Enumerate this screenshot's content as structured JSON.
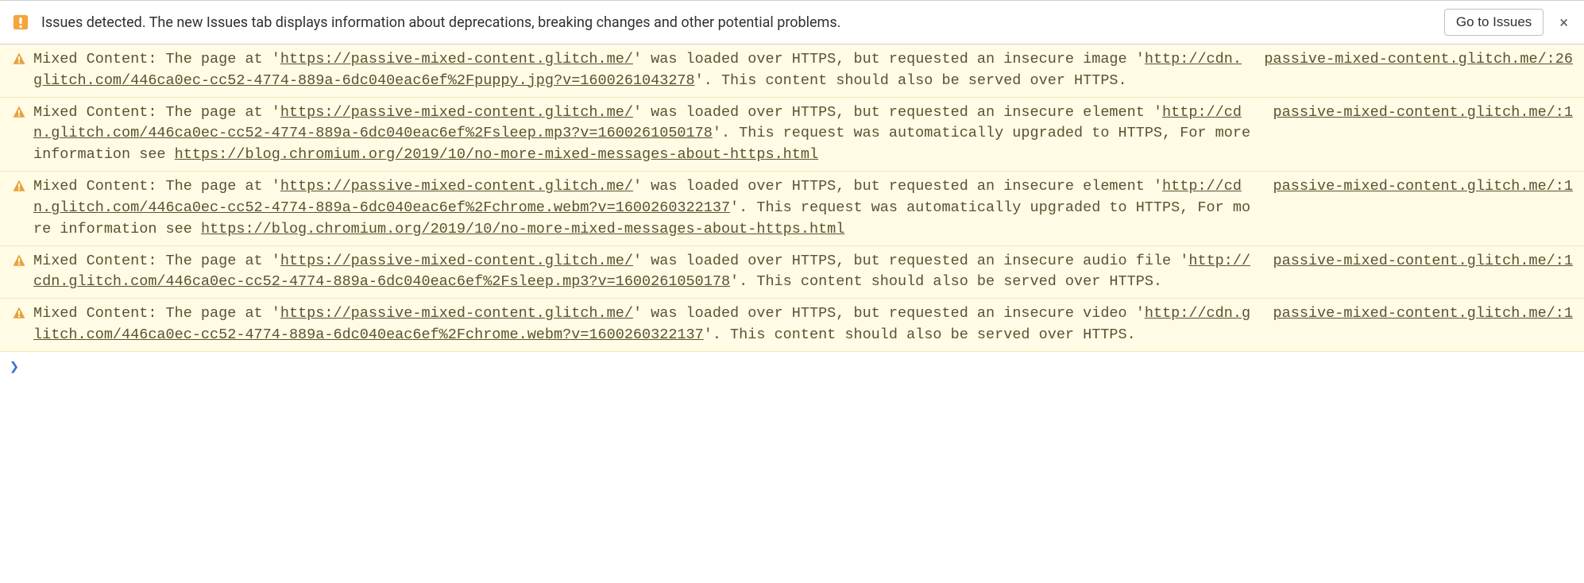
{
  "issues_bar": {
    "message": "Issues detected. The new Issues tab displays information about deprecations, breaking changes and other potential problems.",
    "button_label": "Go to Issues",
    "close_label": "×"
  },
  "prompt": "❯",
  "messages": [
    {
      "pre": "Mixed Content: The page at '",
      "url1": "https://passive-mixed-content.glitch.me/",
      "mid1": "' was loaded over HTTPS, but requested an insecure image '",
      "url2": "http://cdn.glitch.com/446ca0ec-cc52-4774-889a-6dc040eac6ef%2Fpuppy.jpg?v=1600261043278",
      "mid2": "'. This content should also be served over HTTPS.",
      "url3": "",
      "post": "",
      "source": "passive-mixed-content.glitch.me/:26"
    },
    {
      "pre": "Mixed Content: The page at '",
      "url1": "https://passive-mixed-content.glitch.me/",
      "mid1": "' was loaded over HTTPS, but requested an insecure element '",
      "url2": "http://cdn.glitch.com/446ca0ec-cc52-4774-889a-6dc040eac6ef%2Fsleep.mp3?v=1600261050178",
      "mid2": "'. This request was automatically upgraded to HTTPS, For more information see ",
      "url3": "https://blog.chromium.org/2019/10/no-more-mixed-messages-about-https.html",
      "post": "",
      "source": "passive-mixed-content.glitch.me/:1"
    },
    {
      "pre": "Mixed Content: The page at '",
      "url1": "https://passive-mixed-content.glitch.me/",
      "mid1": "' was loaded over HTTPS, but requested an insecure element '",
      "url2": "http://cdn.glitch.com/446ca0ec-cc52-4774-889a-6dc040eac6ef%2Fchrome.webm?v=1600260322137",
      "mid2": "'. This request was automatically upgraded to HTTPS, For more information see ",
      "url3": "https://blog.chromium.org/2019/10/no-more-mixed-messages-about-https.html",
      "post": "",
      "source": "passive-mixed-content.glitch.me/:1"
    },
    {
      "pre": "Mixed Content: The page at '",
      "url1": "https://passive-mixed-content.glitch.me/",
      "mid1": "' was loaded over HTTPS, but requested an insecure audio file '",
      "url2": "http://cdn.glitch.com/446ca0ec-cc52-4774-889a-6dc040eac6ef%2Fsleep.mp3?v=1600261050178",
      "mid2": "'. This content should also be served over HTTPS.",
      "url3": "",
      "post": "",
      "source": "passive-mixed-content.glitch.me/:1"
    },
    {
      "pre": "Mixed Content: The page at '",
      "url1": "https://passive-mixed-content.glitch.me/",
      "mid1": "' was loaded over HTTPS, but requested an insecure video '",
      "url2": "http://cdn.glitch.com/446ca0ec-cc52-4774-889a-6dc040eac6ef%2Fchrome.webm?v=1600260322137",
      "mid2": "'. This content should also be served over HTTPS.",
      "url3": "",
      "post": "",
      "source": "passive-mixed-content.glitch.me/:1"
    }
  ]
}
